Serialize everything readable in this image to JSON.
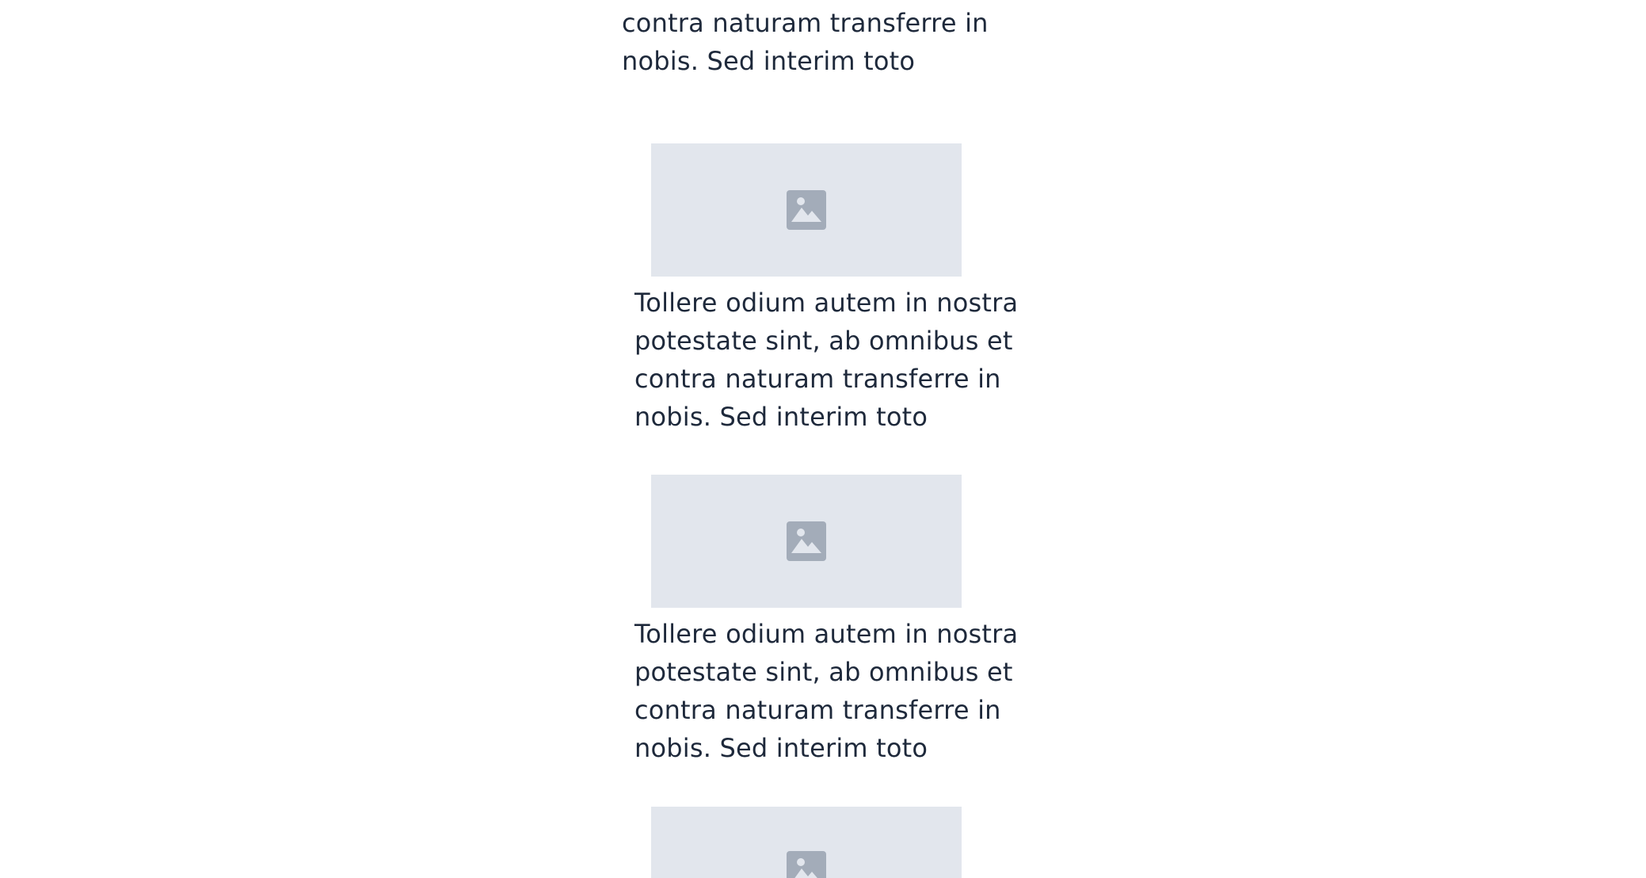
{
  "items": [
    {
      "lines": [
        "contra naturam transferre in",
        "nobis. Sed interim toto"
      ]
    },
    {
      "image_icon": "image-placeholder-icon",
      "lines": [
        "Tollere odium autem in nostra",
        "potestate sint, ab omnibus et",
        "contra naturam transferre in",
        "nobis. Sed interim toto"
      ]
    },
    {
      "image_icon": "image-placeholder-icon",
      "lines": [
        "Tollere odium autem in nostra",
        "potestate sint, ab omnibus et",
        "contra naturam transferre in",
        "nobis. Sed interim toto"
      ]
    },
    {
      "image_icon": "image-placeholder-icon"
    }
  ],
  "colors": {
    "text": "#1e293b",
    "placeholder_bg": "#e2e6ed",
    "placeholder_icon": "#a3acb9"
  }
}
